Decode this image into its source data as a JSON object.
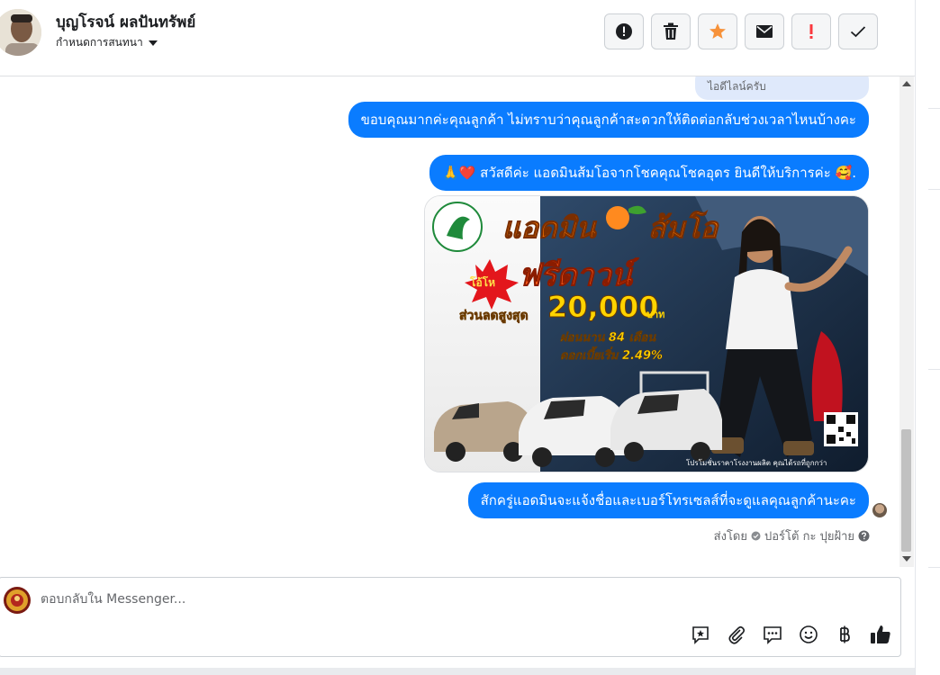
{
  "header": {
    "contact_name": "บุญโรจน์ ผลปันทรัพย์",
    "thread_label": "กำหนดการสนทนา"
  },
  "actions": [
    {
      "name": "alert-action-button",
      "icon": "alert-circle-icon"
    },
    {
      "name": "delete-action-button",
      "icon": "trash-icon"
    },
    {
      "name": "star-action-button",
      "icon": "star-icon"
    },
    {
      "name": "mark-unread-action-button",
      "icon": "envelope-icon"
    },
    {
      "name": "flag-spam-action-button",
      "icon": "exclamation-icon"
    },
    {
      "name": "mark-done-action-button",
      "icon": "check-icon"
    }
  ],
  "conversation": {
    "previous_message": "ไอดีไลน์ครับ",
    "messages": [
      {
        "text": "ขอบคุณมากค่ะคุณลูกค้า ไม่ทราบว่าคุณลูกค้าสะดวกให้ติดต่อกลับช่วงเวลาไหนบ้างคะ"
      },
      {
        "text": "🙏❤️ สวัสดีค่ะ แอดมินส้มโอจากโชคคุณโชคอุดร ยินดีให้บริการค่ะ 🥰."
      },
      {
        "text": "สักครู่แอดมินจะแจ้งชื่อและเบอร์โทรเซลส์ที่จะดูแลคุณลูกค้านะคะ"
      }
    ],
    "promo": {
      "headline": "แอดมิน",
      "headline2": "ส้มโอ",
      "badge": "โอ้โห",
      "offer": "ฟรีดาวน์",
      "discount_label": "ส่วนลดสูงสุด",
      "discount_value": "20,000",
      "discount_unit": "บาท",
      "installment": "ผ่อนนาน 84 เดือน",
      "interest": "ดอกเบี้ยเริ่ม 2.49%",
      "footer": "โปรโมชั่นราคาโรงงานผลิต คุณได้รถที่ถูกกว่า"
    },
    "sent_by_label": "ส่งโดย",
    "sent_by_name": "ปอร์โต้ กะ ปุยฝ้าย"
  },
  "composer": {
    "placeholder": "ตอบกลับใน Messenger..."
  },
  "colors": {
    "bubble_blue": "#0a7cff",
    "star_orange": "#f7923a",
    "flag_red": "#fa383e",
    "promo_orange": "#ff7a00",
    "promo_yellow": "#ffd400"
  }
}
